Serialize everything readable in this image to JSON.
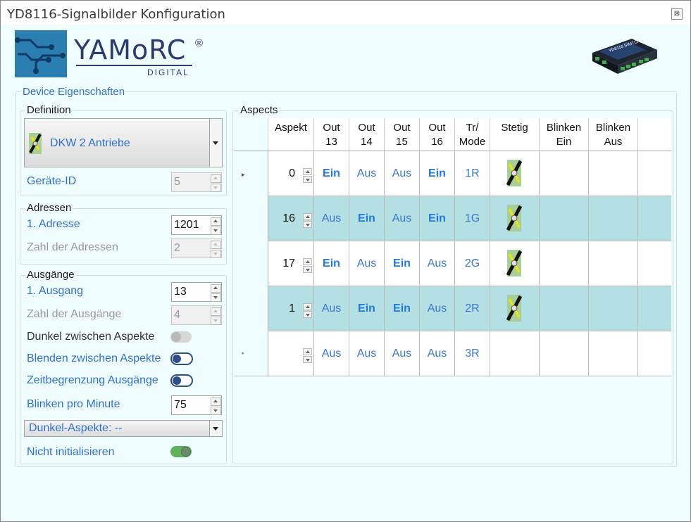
{
  "window": {
    "title": "YD8116-Signalbilder Konfiguration",
    "close_glyph": "⊠"
  },
  "logo": {
    "brand": "YAMoRC",
    "reg": "®",
    "sub": "DIGITAL"
  },
  "device_image": {
    "label": "YD8116 SWITCH"
  },
  "device_group": {
    "legend": "Device Eigenschaften"
  },
  "definition": {
    "legend": "Definition",
    "selected": "DKW 2 Antriebe",
    "geraete_id_label": "Geräte-ID",
    "geraete_id": "5"
  },
  "adressen": {
    "legend": "Adressen",
    "first_label": "1. Adresse",
    "first_value": "1201",
    "count_label": "Zahl der Adressen",
    "count_value": "2"
  },
  "ausgaenge": {
    "legend": "Ausgänge",
    "first_label": "1. Ausgang",
    "first_value": "13",
    "count_label": "Zahl der Ausgänge",
    "count_value": "4",
    "dunkel_label": "Dunkel zwischen Aspekte",
    "blenden_label": "Blenden zwischen Aspekte",
    "zeit_label": "Zeitbegrenzung Ausgänge",
    "blinken_label": "Blinken pro Minute",
    "blinken_value": "75",
    "dunkel_aspekte": "Dunkel-Aspekte: --",
    "nicht_init_label": "Nicht initialisieren",
    "toggles": {
      "dunkel": false,
      "blenden": false,
      "zeit": false,
      "nicht_init": true
    }
  },
  "aspects": {
    "legend": "Aspects",
    "columns": [
      "Aspekt",
      "Out 13",
      "Out 14",
      "Out 15",
      "Out 16",
      "Tr/ Mode",
      "Stetig",
      "Blinken Ein",
      "Blinken Aus"
    ],
    "rows": [
      {
        "marker": "▸",
        "aspekt": "0",
        "out": [
          "Ein",
          "Aus",
          "Aus",
          "Ein"
        ],
        "mode": "1R",
        "highlight": false
      },
      {
        "marker": "",
        "aspekt": "16",
        "out": [
          "Aus",
          "Ein",
          "Aus",
          "Ein"
        ],
        "mode": "1G",
        "highlight": true
      },
      {
        "marker": "",
        "aspekt": "17",
        "out": [
          "Ein",
          "Aus",
          "Ein",
          "Aus"
        ],
        "mode": "2G",
        "highlight": false
      },
      {
        "marker": "",
        "aspekt": "1",
        "out": [
          "Aus",
          "Ein",
          "Ein",
          "Aus"
        ],
        "mode": "2R",
        "highlight": true
      },
      {
        "marker": "*",
        "aspekt": "",
        "out": [
          "Aus",
          "Aus",
          "Aus",
          "Aus"
        ],
        "mode": "3R",
        "highlight": false
      }
    ]
  },
  "colors": {
    "highlight_row": "#b4e0e3",
    "accent_blue": "#2e6fd6",
    "brand": "#2b3a73"
  }
}
